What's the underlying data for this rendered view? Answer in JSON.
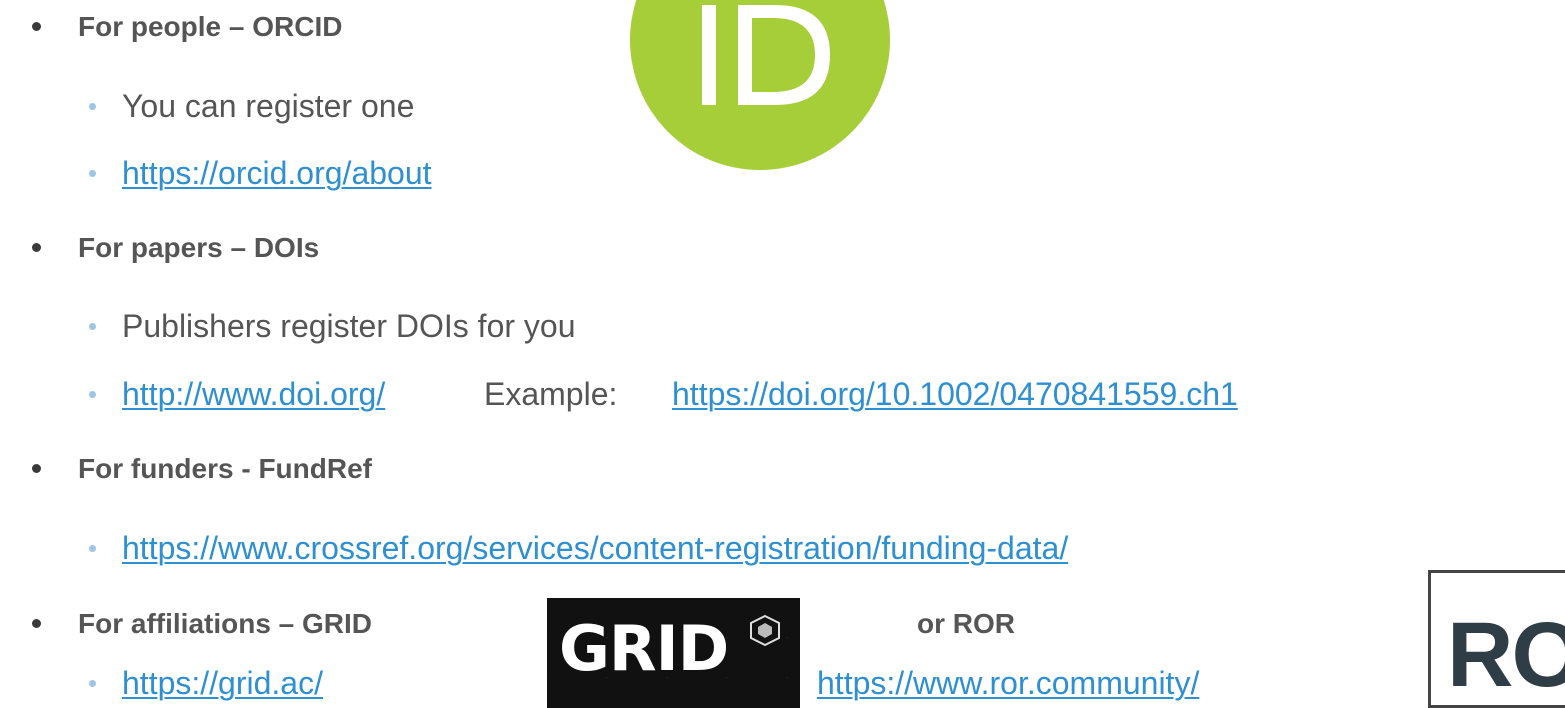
{
  "items": [
    {
      "heading": "For people – ORCID",
      "children": [
        {
          "text": "You can register one"
        },
        {
          "link": "https://orcid.org/about"
        }
      ]
    },
    {
      "heading": "For papers – DOIs",
      "children": [
        {
          "text": "Publishers register DOIs for you"
        },
        {
          "link": "http://www.doi.org/",
          "example_label": "Example: ",
          "example_link": "https://doi.org/10.1002/0470841559.ch1"
        }
      ]
    },
    {
      "heading": "For funders - FundRef",
      "children": [
        {
          "link": "https://www.crossref.org/services/content-registration/funding-data/"
        }
      ]
    },
    {
      "heading": "For affiliations – GRID",
      "heading_extra": "or ROR",
      "children": [
        {
          "link": "https://grid.ac/",
          "link2": "https://www.ror.community/"
        }
      ]
    }
  ],
  "logos": {
    "orcid": {
      "text": "iD",
      "color": "#a6ce39"
    },
    "grid": {
      "text": "GRID",
      "background": "#111111"
    },
    "ror": {
      "text": "ROR",
      "color": "#2f3e46"
    }
  },
  "colors": {
    "link": "#2e8fd1",
    "text": "#555555",
    "sub_bullet": "#9ec6e4"
  }
}
